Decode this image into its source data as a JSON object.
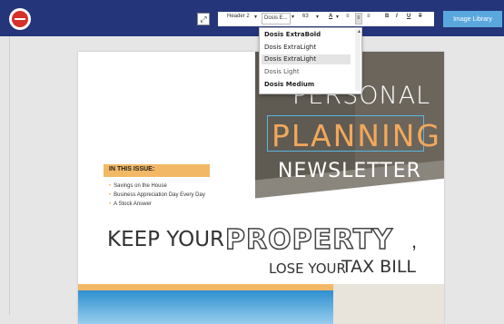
{
  "header": {
    "image_library_label": "Image Library",
    "toolbar": {
      "style_select": "Header 2",
      "font_select": "Dosis E...",
      "size_select": "63",
      "font_color": "A",
      "align_left": "≡",
      "align_center": "≡",
      "align_right": "≡",
      "bold": "B",
      "italic": "I",
      "underline": "U",
      "clear_format": "T"
    }
  },
  "font_dropdown": {
    "items": [
      "Dosis ExtraBold",
      "Dosis ExtraLight",
      "Dosis ExtraLight",
      "Dosis Light",
      "Dosis Medium"
    ],
    "highlighted_index": 2
  },
  "newsletter": {
    "title_line1": "PERSONAL",
    "title_line2": "PLANNING",
    "title_line3": "NEWSLETTER",
    "issue_heading": "IN THIS ISSUE:",
    "issue_items": [
      "Savings on the House",
      "Business Appreciation Day Every Day",
      "A Stock Answer"
    ],
    "headline_part1": "KEEP YOUR",
    "headline_part2": "PROPERTY",
    "headline_part3": ",",
    "sub_part1": "LOSE YOUR",
    "sub_part2": "TAX BILL"
  },
  "colors": {
    "topbar": "#24357a",
    "accent_orange": "#f2b866",
    "button_blue": "#5aa7de"
  }
}
